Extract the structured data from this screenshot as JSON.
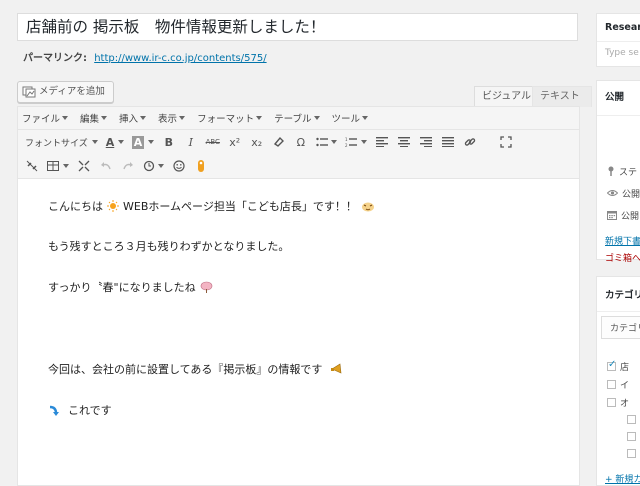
{
  "post": {
    "title": "店舗前の 掲示板　物件情報更新しました！",
    "permalink_label": "パーマリンク:",
    "permalink_url": "http://www.ir-c.co.jp/contents/575/"
  },
  "editor": {
    "media_button": "メディアを追加",
    "tabs": {
      "visual": "ビジュアル",
      "text": "テキスト"
    },
    "menu": [
      "ファイル",
      "編集",
      "挿入",
      "表示",
      "フォーマット",
      "テーブル",
      "ツール"
    ],
    "font_size_label": "フォントサイズ",
    "toolbar_labels": {
      "font_color": "A",
      "bg_color": "A",
      "bold": "B",
      "italic": "I",
      "strike": "ABC",
      "sup": "x²",
      "sub": "x₂",
      "omega": "Ω"
    },
    "content": {
      "line1": "こんにちは",
      "line1b": "WEBホームページ担当「こども店長」です！！",
      "line2": "もう残すところ３月も残りわずかとなりました。",
      "line3": "すっかり〝春\"になりましたね",
      "line4": "今回は、会社の前に設置してある『掲示板』の情報です",
      "line5": "これです"
    }
  },
  "sidebar": {
    "research_title": "Resear",
    "research_placeholder": "Type se",
    "publish_title": "公開",
    "rows": [
      "ステ",
      "公開",
      "公開"
    ],
    "draft_link": "新規下書",
    "trash_link": "ゴミ箱へ",
    "category_title": "カテゴリ",
    "category_tab": "カテゴリ",
    "categories": [
      "店",
      "イ",
      "オ"
    ],
    "add_new": "+ 新規カ"
  },
  "colors": {
    "accent": "#0073aa",
    "danger": "#a00000"
  }
}
